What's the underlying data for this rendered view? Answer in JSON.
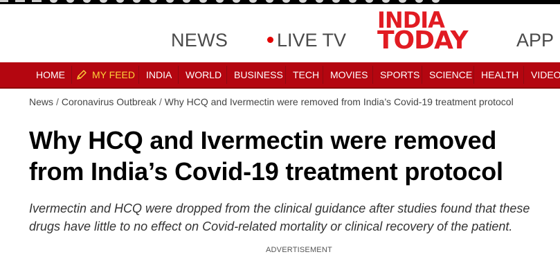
{
  "masthead": {
    "news_label": "NEWS",
    "live_tv_label": "LIVE TV",
    "logo_line1": "INDIA",
    "logo_line2": "TODAY",
    "app_label": "APP",
    "brand_color": "#e11b22"
  },
  "nav": {
    "items": [
      "HOME",
      "MY FEED",
      "INDIA",
      "WORLD",
      "BUSINESS",
      "TECH",
      "MOVIES",
      "SPORTS",
      "SCIENCE",
      "HEALTH",
      "VIDEO"
    ],
    "background_color": "#b40610",
    "feed_color": "#ffd23a"
  },
  "breadcrumb": {
    "items": [
      "News",
      "Coronavirus Outbreak",
      "Why HCQ and Ivermectin were removed from India’s Covid-19 treatment protocol"
    ],
    "separator": "/"
  },
  "article": {
    "headline_line1": "Why HCQ and Ivermectin were removed",
    "headline_line2": "from India’s Covid-19 treatment protocol",
    "summary_line1": "Ivermectin and HCQ were dropped from the clinical guidance after studies found that these",
    "summary_line2": "drugs have little to no effect on Covid-related mortality or clinical recovery of the patient."
  },
  "ad_label": "ADVERTISEMENT"
}
